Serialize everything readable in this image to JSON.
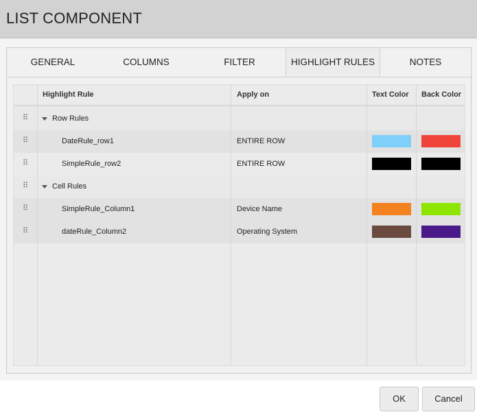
{
  "dialog": {
    "title": "LIST COMPONENT"
  },
  "tabs": [
    {
      "label": "GENERAL",
      "active": false
    },
    {
      "label": "COLUMNS",
      "active": false
    },
    {
      "label": "FILTER",
      "active": false
    },
    {
      "label": "HIGHLIGHT RULES",
      "active": true
    },
    {
      "label": "NOTES",
      "active": false
    }
  ],
  "grid": {
    "headers": {
      "highlight_rule": "Highlight Rule",
      "apply_on": "Apply on",
      "text_color": "Text Color",
      "back_color": "Back Color"
    },
    "drag_glyph": "⠿",
    "rows": [
      {
        "type": "group",
        "name": "Row Rules",
        "apply_on": ""
      },
      {
        "type": "rule",
        "name": "DateRule_row1",
        "apply_on": "ENTIRE ROW",
        "text_color": "#7fd0f8",
        "back_color": "#f0443a"
      },
      {
        "type": "rule",
        "name": "SimpleRule_row2",
        "apply_on": "ENTIRE ROW",
        "text_color": "#000000",
        "back_color": "#000000"
      },
      {
        "type": "group",
        "name": "Cell Rules",
        "apply_on": ""
      },
      {
        "type": "rule",
        "name": "SimpleRule_Column1",
        "apply_on": "Device Name",
        "text_color": "#f58220",
        "back_color": "#8ee600"
      },
      {
        "type": "rule",
        "name": "dateRule_Column2",
        "apply_on": "Operating System",
        "text_color": "#6b4a40",
        "back_color": "#4a1a8a"
      }
    ]
  },
  "buttons": {
    "ok": "OK",
    "cancel": "Cancel"
  }
}
